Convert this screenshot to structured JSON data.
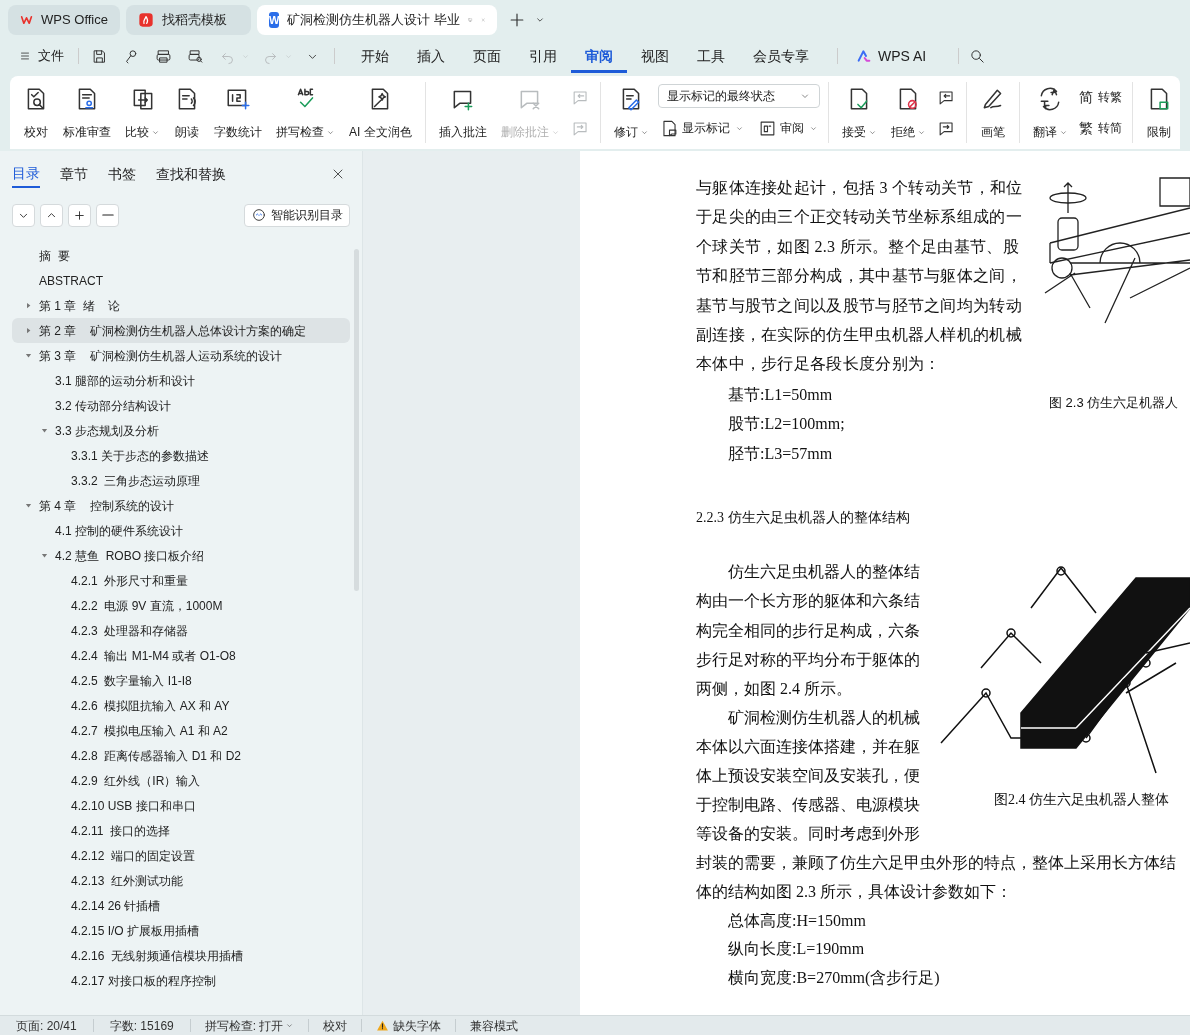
{
  "tabs": [
    {
      "label": "WPS Office",
      "selected": false,
      "kind": "home"
    },
    {
      "label": "找稻壳模板",
      "selected": false,
      "kind": "template"
    },
    {
      "label": "矿洞检测仿生机器人设计 毕业",
      "selected": true,
      "kind": "document",
      "badge": "W"
    }
  ],
  "menu": {
    "file": "文件",
    "quick_actions": [
      {
        "disabled": false
      },
      {
        "disabled": false
      },
      {
        "disabled": false
      },
      {
        "disabled": false
      },
      {
        "disabled": true
      },
      {
        "disabled": true
      }
    ],
    "tabs": [
      {
        "label": "开始",
        "selected": false
      },
      {
        "label": "插入",
        "selected": false
      },
      {
        "label": "页面",
        "selected": false
      },
      {
        "label": "引用",
        "selected": false
      },
      {
        "label": "审阅",
        "selected": true
      },
      {
        "label": "视图",
        "selected": false
      },
      {
        "label": "工具",
        "selected": false
      },
      {
        "label": "会员专享",
        "selected": false
      }
    ],
    "ai": "WPS AI"
  },
  "ribbon": [
    [
      {
        "kind": "large",
        "label": "校对",
        "dropdown": false,
        "disabled": false
      },
      {
        "kind": "large",
        "label": "标准审查",
        "dropdown": false,
        "disabled": false
      },
      {
        "kind": "large",
        "label": "比较",
        "dropdown": true,
        "disabled": false
      },
      {
        "kind": "large",
        "label": "朗读",
        "dropdown": false,
        "disabled": false
      },
      {
        "kind": "large",
        "label": "字数统计",
        "dropdown": false,
        "disabled": false
      },
      {
        "kind": "large",
        "label": "拼写检查",
        "dropdown": true,
        "disabled": false
      },
      {
        "kind": "large",
        "label": "AI 全文润色",
        "dropdown": false,
        "disabled": false
      }
    ],
    [
      {
        "kind": "large",
        "label": "插入批注",
        "dropdown": false,
        "disabled": false
      },
      {
        "kind": "large",
        "label": "删除批注",
        "dropdown": true,
        "disabled": true
      },
      {
        "kind": "stack",
        "rows": [
          [
            {
              "kind": "small",
              "dropdown": false,
              "disabled": true
            }
          ],
          [
            {
              "kind": "small",
              "dropdown": false,
              "disabled": true
            }
          ]
        ]
      }
    ],
    [
      {
        "kind": "large",
        "label": "修订",
        "dropdown": true,
        "disabled": false
      },
      {
        "kind": "stack",
        "rows": [
          [
            {
              "kind": "select",
              "value": "显示标记的最终状态"
            }
          ],
          [
            {
              "kind": "small",
              "label": "显示标记",
              "dropdown": true,
              "disabled": false
            },
            {
              "kind": "small",
              "label": "审阅",
              "dropdown": true,
              "disabled": false
            }
          ]
        ]
      }
    ],
    [
      {
        "kind": "large",
        "label": "接受",
        "dropdown": true,
        "disabled": false
      },
      {
        "kind": "large",
        "label": "拒绝",
        "dropdown": true,
        "disabled": false
      },
      {
        "kind": "stack",
        "rows": [
          [
            {
              "kind": "small",
              "dropdown": false,
              "disabled": false
            }
          ],
          [
            {
              "kind": "small",
              "dropdown": false,
              "disabled": false
            }
          ]
        ]
      }
    ],
    [
      {
        "kind": "large",
        "label": "画笔",
        "dropdown": false,
        "disabled": false
      }
    ],
    [
      {
        "kind": "large",
        "label": "翻译",
        "dropdown": true,
        "disabled": false
      },
      {
        "kind": "stack",
        "rows": [
          [
            {
              "kind": "small",
              "label": "转繁",
              "glyph": "简",
              "dropdown": false,
              "disabled": false
            }
          ],
          [
            {
              "kind": "small",
              "label": "转简",
              "glyph": "繁",
              "dropdown": false,
              "disabled": false
            }
          ]
        ]
      }
    ],
    [
      {
        "kind": "large",
        "label": "限制",
        "dropdown": false,
        "disabled": false
      }
    ]
  ],
  "sidebar": {
    "tabs": [
      {
        "label": "目录",
        "selected": true
      },
      {
        "label": "章节",
        "selected": false
      },
      {
        "label": "书签",
        "selected": false
      },
      {
        "label": "查找和替换",
        "selected": false
      }
    ],
    "smart_toc_button": "智能识别目录",
    "toc": [
      {
        "label": "摘  要",
        "selected": false
      },
      {
        "label": "ABSTRACT",
        "selected": false
      },
      {
        "label": "第 1 章  绪    论",
        "selected": false,
        "expanded": false
      },
      {
        "label": "第 2 章    矿洞检测仿生机器人总体设计方案的确定",
        "selected": true,
        "expanded": false
      },
      {
        "label": "第 3 章    矿洞检测仿生机器人运动系统的设计",
        "selected": false,
        "expanded": true,
        "children": [
          {
            "label": "3.1 腿部的运动分析和设计",
            "selected": false
          },
          {
            "label": "3.2 传动部分结构设计",
            "selected": false
          },
          {
            "label": "3.3 步态规划及分析",
            "selected": false,
            "expanded": true,
            "children": [
              {
                "label": "3.3.1 关于步态的参数描述",
                "selected": false
              },
              {
                "label": "3.3.2  三角步态运动原理",
                "selected": false
              }
            ]
          }
        ]
      },
      {
        "label": "第 4 章    控制系统的设计",
        "selected": false,
        "expanded": true,
        "children": [
          {
            "label": "4.1 控制的硬件系统设计",
            "selected": false
          },
          {
            "label": "4.2 慧鱼  ROBO 接口板介绍",
            "selected": false,
            "expanded": true,
            "children": [
              {
                "label": "4.2.1  外形尺寸和重量",
                "selected": false
              },
              {
                "label": "4.2.2  电源 9V 直流，1000M",
                "selected": false
              },
              {
                "label": "4.2.3  处理器和存储器",
                "selected": false
              },
              {
                "label": "4.2.4  输出 M1-M4 或者 O1-O8",
                "selected": false
              },
              {
                "label": "4.2.5  数字量输入 I1-I8",
                "selected": false
              },
              {
                "label": "4.2.6  模拟阻抗输入 AX 和 AY",
                "selected": false
              },
              {
                "label": "4.2.7  模拟电压输入 A1 和 A2",
                "selected": false
              },
              {
                "label": "4.2.8  距离传感器输入 D1 和 D2",
                "selected": false
              },
              {
                "label": "4.2.9  红外线（IR）输入",
                "selected": false
              },
              {
                "label": "4.2.10 USB 接口和串口",
                "selected": false
              },
              {
                "label": "4.2.11  接口的选择",
                "selected": false
              },
              {
                "label": "4.2.12  端口的固定设置",
                "selected": false
              },
              {
                "label": "4.2.13  红外测试功能",
                "selected": false
              },
              {
                "label": "4.2.14 26 针插槽",
                "selected": false
              },
              {
                "label": "4.2.15 I/O 扩展板用插槽",
                "selected": false
              },
              {
                "label": "4.2.16  无线射频通信模块用插槽",
                "selected": false
              },
              {
                "label": "4.2.17 对接口板的程序控制",
                "selected": false
              }
            ]
          }
        ]
      }
    ]
  },
  "document": {
    "block_1": {
      "paragraph": "与躯体连接处起计，包括 3 个转动关节，和位于足尖的由三个正交转动关节坐标系组成的一个球关节，如图 2.3 所示。整个足由基节、股节和胫节三部分构成，其中基节与躯体之间，基节与股节之间以及股节与胫节之间均为转动副连接，在实际的仿生甲虫机器人样机的机械本体中，步行足各段长度分别为：",
      "lines": [
        "基节:L1=50mm",
        "股节:L2=100mm;",
        "胫节:L3=57mm"
      ],
      "caption": "图 2.3 仿生六足机器人"
    },
    "heading": "2.2.3 仿生六足虫机器人的整体结构",
    "block_2": {
      "paragraphs": [
        "仿生六足虫机器人的整体结构由一个长方形的躯体和六条结构完全相同的步行足构成，六条步行足对称的平均分布于躯体的两侧，如图 2.4 所示。",
        "矿洞检测仿生机器人的机械本体以六面连接体搭建，并在躯体上预设安装空间及安装孔，便于控制电路、传感器、电源模块等设备的安装。同时考虑到外形"
      ],
      "caption": "图2.4 仿生六足虫机器人整体"
    },
    "continued_lines": [
      "封装的需要，兼顾了仿生六足甲虫外形的特点，整体上采用长方体结",
      "体的结构如图 2.3 所示，具体设计参数如下："
    ],
    "parameters": [
      "总体高度:H=150mm",
      "纵向长度:L=190mm",
      "横向宽度:B=270mm(含步行足)"
    ]
  },
  "status_bar": {
    "page": "页面: 20/41",
    "words": "字数: 15169",
    "spell_check": "拼写检查: 打开",
    "proofread": "校对",
    "missing_fonts": "缺失字体",
    "compat": "兼容模式"
  }
}
